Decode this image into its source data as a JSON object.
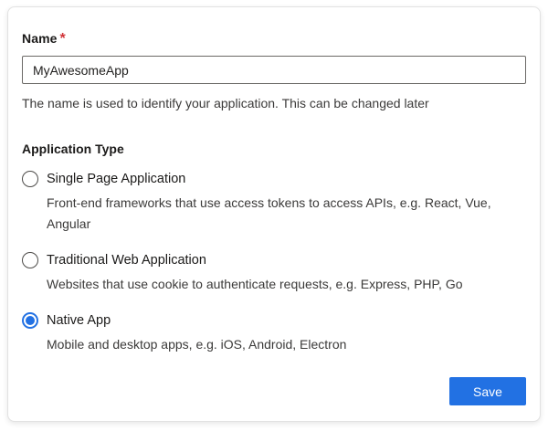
{
  "form": {
    "name_field": {
      "label": "Name",
      "required_marker": "*",
      "value": "MyAwesomeApp",
      "help_text": "The name is used to identify your application. This can be changed later"
    },
    "application_type": {
      "label": "Application Type",
      "options": [
        {
          "label": "Single Page Application",
          "description": "Front-end frameworks that use access tokens to access APIs, e.g. React, Vue, Angular",
          "selected": false
        },
        {
          "label": "Traditional Web Application",
          "description": "Websites that use cookie to authenticate requests, e.g. Express, PHP, Go",
          "selected": false
        },
        {
          "label": "Native App",
          "description": "Mobile and desktop apps, e.g. iOS, Android, Electron",
          "selected": true
        }
      ]
    },
    "save_button": {
      "label": "Save"
    }
  },
  "colors": {
    "accent_blue": "#2271e3",
    "required_red": "#d13438"
  }
}
